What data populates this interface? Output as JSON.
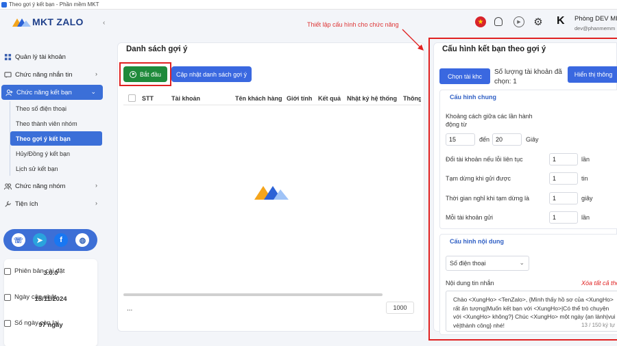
{
  "window": {
    "title": "Theo gợi ý kết bạn - Phần mềm MKT"
  },
  "logo": {
    "text": "MKT ZALO"
  },
  "sidebar": {
    "items": [
      {
        "label": "Quản lý tài khoản"
      },
      {
        "label": "Chức năng nhắn tin"
      },
      {
        "label": "Chức năng kết bạn"
      },
      {
        "label": "Chức năng nhóm"
      },
      {
        "label": "Tiện ích"
      }
    ],
    "sub_items": [
      {
        "label": "Theo số điện thoại"
      },
      {
        "label": "Theo thành viên nhóm"
      },
      {
        "label": "Theo gợi ý kết bạn"
      },
      {
        "label": "Hủy/Đồng ý kết bạn"
      },
      {
        "label": "Lịch sử kết bạn"
      }
    ]
  },
  "info": {
    "version_label": "Phiên bản cài đặt",
    "version_value": "3.0.0",
    "updated_label": "Ngày cập nhật",
    "updated_value": "15/11/2024",
    "days_label": "Số ngày còn lại",
    "days_value": "97 ngày"
  },
  "user": {
    "name": "Phòng DEV MI",
    "email": "dev@phanmemm"
  },
  "list_panel": {
    "title": "Danh sách gợi ý",
    "start_label": "Bắt đầu",
    "update_label": "Cập nhật danh sách gợi ý",
    "columns": [
      "STT",
      "Tài khoản",
      "Tên khách hàng",
      "Giới tính",
      "Kết quả",
      "Nhật ký hệ thống",
      "Thông"
    ],
    "footer_dots": "...",
    "page_size": "1000"
  },
  "annotation": "Thiết lập cấu hình cho chức năng",
  "config": {
    "title": "Cấu hình kết bạn theo gợi ý",
    "choose_label": "Chọn tài khc",
    "account_count": "Số lượng tài khoản đã chọn: 1",
    "show_label": "Hiển thị thông",
    "general_title": "Cấu hình chung",
    "interval_label": "Khoảng cách giữa các lần hành động từ",
    "interval_from": "15",
    "interval_to_word": "đến",
    "interval_to": "20",
    "seconds": "Giây",
    "switch_label": "Đổi tài khoản nếu lỗi liên tục",
    "switch_value": "1",
    "switch_unit": "lần",
    "pause_label": "Tạm dừng khi gửi được",
    "pause_value": "1",
    "pause_unit": "tin",
    "rest_label": "Thời gian nghỉ khi tạm dừng là",
    "rest_value": "1",
    "rest_unit": "giây",
    "each_label": "Mỗi tài khoản gửi",
    "each_value": "1",
    "each_unit": "lần",
    "content_title": "Cấu hình nội dung",
    "select_value": "Số điện thoại",
    "message_label": "Nội dung tin nhắn",
    "clear_label": "Xóa tất cả the",
    "message_text": "Chào <XungHo> <TenZalo>, {Mình thấy hồ sơ của <XungHo> rất ấn tượng|Muốn kết bạn với <XungHo>|Có thể trò chuyện với <XungHo> không?} Chúc <XungHo> một ngày {an lành|vui vẻ|thành công} nhé!",
    "counter": "13 / 150 ký tự"
  },
  "colors": {
    "accent": "#3a68e0",
    "start": "#1f8a3b",
    "highlight": "#e02020"
  }
}
